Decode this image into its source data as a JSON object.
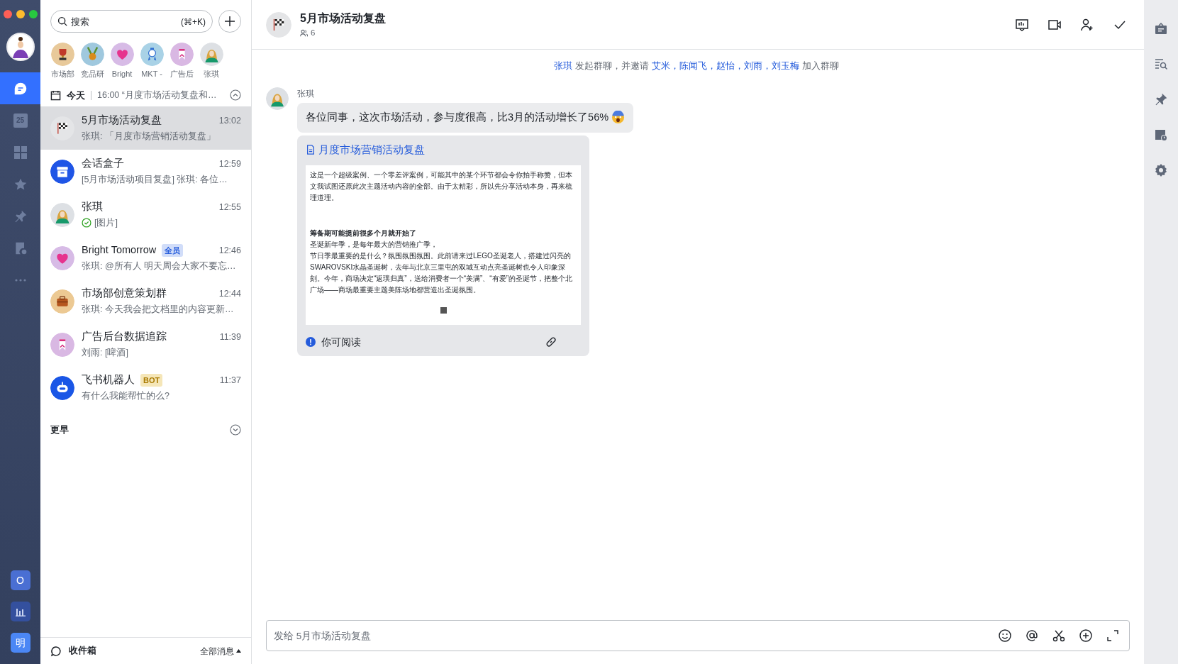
{
  "nav_rail": {
    "items": [
      {
        "kind": "chat",
        "selected": true
      },
      {
        "kind": "calendar",
        "label": "25",
        "selected": false
      },
      {
        "kind": "apps",
        "selected": false
      },
      {
        "kind": "star",
        "selected": false
      },
      {
        "kind": "pin",
        "selected": false
      },
      {
        "kind": "docs",
        "selected": false
      },
      {
        "kind": "more",
        "selected": false
      }
    ],
    "bottom_apps": [
      {
        "kind": "letter",
        "label": "O",
        "color": "#4a6fd3"
      },
      {
        "kind": "chart",
        "color": "#34509e"
      },
      {
        "kind": "letter",
        "label": "明",
        "color": "#4b87f5"
      }
    ]
  },
  "chat_list": {
    "search": {
      "placeholder": "搜索",
      "shortcut": "(⌘+K)"
    },
    "pinned": [
      {
        "label": "市场部",
        "avatar": {
          "kind": "trophy",
          "color": "#e8c99a"
        }
      },
      {
        "label": "竞品研",
        "avatar": {
          "kind": "medal",
          "color": "#9fc8de"
        }
      },
      {
        "label": "Bright",
        "avatar": {
          "kind": "heart",
          "color": "#d7bbe6"
        }
      },
      {
        "label": "MKT -",
        "avatar": {
          "kind": "badge",
          "color": "#a9d2e6"
        }
      },
      {
        "label": "广告后",
        "avatar": {
          "kind": "bookmark",
          "color": "#d9b8e3"
        }
      },
      {
        "label": "张琪",
        "avatar": {
          "kind": "person",
          "color": "#dde0e4"
        }
      }
    ],
    "today": {
      "label": "今天",
      "event": "16:00 “月度市场活动复盘和…",
      "expanded": true
    },
    "chats": [
      {
        "title": "5月市场活动复盘",
        "avatar": {
          "kind": "flag",
          "color": "#e4e5e7"
        },
        "time": "13:02",
        "preview": "张琪: 「月度市场营销活动复盘」",
        "selected": true,
        "read": false
      },
      {
        "title": "会话盒子",
        "avatar": {
          "kind": "box",
          "color": "#1f55e6"
        },
        "time": "12:59",
        "preview": "[5月市场活动项目复盘] 张琪: 各位…",
        "selected": false,
        "read": false
      },
      {
        "title": "张琪",
        "avatar": {
          "kind": "person",
          "color": "#dde0e4"
        },
        "time": "12:55",
        "preview": "[图片]",
        "selected": false,
        "read": true
      },
      {
        "title": "Bright Tomorrow",
        "badge": {
          "kind": "all",
          "text": "全员"
        },
        "avatar": {
          "kind": "heart",
          "color": "#d7bbe6"
        },
        "time": "12:46",
        "preview": "张琪: @所有人 明天周会大家不要忘…",
        "selected": false,
        "read": false
      },
      {
        "title": "市场部创意策划群",
        "avatar": {
          "kind": "briefcase",
          "color": "#ecc993"
        },
        "time": "12:44",
        "preview": "张琪: 今天我会把文档里的内容更新…",
        "selected": false,
        "read": false
      },
      {
        "title": "广告后台数据追踪",
        "avatar": {
          "kind": "bookmark",
          "color": "#d9b8e3"
        },
        "time": "11:39",
        "preview": "刘雨: [啤酒]",
        "selected": false,
        "read": false
      },
      {
        "title": "飞书机器人",
        "badge": {
          "kind": "bot",
          "text": "BOT"
        },
        "avatar": {
          "kind": "robot",
          "color": "#1a56e6"
        },
        "time": "11:37",
        "preview": "有什么我能帮忙的么?",
        "selected": false,
        "read": false
      }
    ],
    "earlier": {
      "label": "更早",
      "expanded": false
    },
    "footer": {
      "inbox": "收件箱",
      "filter": "全部消息"
    }
  },
  "conversation": {
    "title": "5月市场活动复盘",
    "avatar": {
      "kind": "flag",
      "color": "#e4e5e7"
    },
    "member_count": "6",
    "system_message": [
      {
        "kind": "name",
        "text": "张琪"
      },
      {
        "kind": "plain",
        "text": "发起群聊，并邀请"
      },
      {
        "kind": "name",
        "text": "艾米，"
      },
      {
        "kind": "name",
        "text": "陈闻飞，"
      },
      {
        "kind": "name",
        "text": "赵怡，"
      },
      {
        "kind": "name",
        "text": "刘雨，"
      },
      {
        "kind": "name",
        "text": "刘玉梅"
      },
      {
        "kind": "plain",
        "text": "加入群聊"
      }
    ],
    "messages": [
      {
        "sender": "张琪",
        "avatar": {
          "kind": "person",
          "color": "#dde0e4"
        },
        "text": "各位同事，这次市场活动，参与度很高，比3月的活动增长了56%",
        "doc": {
          "title": "月度市场营销活动复盘",
          "preview": [
            {
              "kind": "para",
              "text": "这是一个超级案例、一个零差评案例，可能其中的某个环节都会令你拍手称赞，但本文我试图还原此次主题活动内容的全部。由于太精彩，所以先分享活动本身，再来梳理道理。"
            },
            {
              "kind": "heading",
              "text": "筹备期可能提前很多个月就开始了"
            },
            {
              "kind": "para",
              "text": "圣诞新年季，是每年最大的营销推广季，"
            },
            {
              "kind": "para",
              "text": "节日季最重要的是什么？氛围氛围氛围。此前请来过LEGO圣诞老人，搭建过闪亮的SWAROVSKI水晶圣诞树，去年与北京三里屯的双城互动点亮圣诞树也令人印象深刻。今年，商场决定“返璞归真”，送给消费者一个“美满”、“有爱”的圣诞节，把整个北广场——商场最重要主题美陈场地都营造出圣诞氛围。"
            },
            {
              "kind": "image"
            }
          ],
          "permission": "你可阅读"
        }
      }
    ],
    "composer": {
      "placeholder": "发给 5月市场活动复盘"
    }
  }
}
